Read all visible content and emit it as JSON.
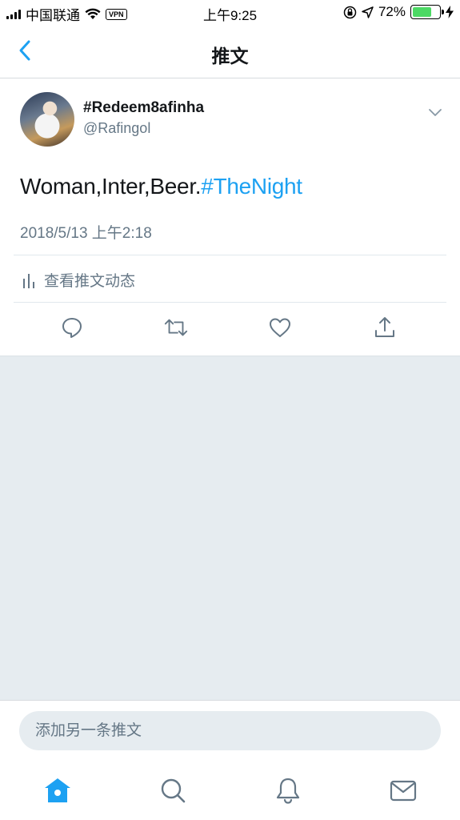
{
  "status_bar": {
    "carrier": "中国联通",
    "vpn_label": "VPN",
    "time": "上午9:25",
    "battery_percent_label": "72%",
    "battery_level": 0.72,
    "battery_color": "#4cd964"
  },
  "nav": {
    "title": "推文",
    "back_icon": "chevron-left-icon"
  },
  "tweet": {
    "display_name": "#Redeem8afinha",
    "handle": "@Rafingol",
    "text_plain": "Woman,Inter,Beer.",
    "text_hashtag": "#TheNight",
    "timestamp": "2018/5/13 上午2:18",
    "activity_label": "查看推文动态",
    "actions": [
      "reply-icon",
      "retweet-icon",
      "like-icon",
      "share-icon"
    ]
  },
  "reply": {
    "placeholder": "添加另一条推文"
  },
  "tab_bar": {
    "tabs": [
      "home-icon",
      "search-icon",
      "notifications-icon",
      "messages-icon"
    ],
    "active": "home-icon"
  },
  "colors": {
    "accent": "#1da1f2",
    "secondary_text": "#657786",
    "background_gray": "#e6ecf0"
  }
}
